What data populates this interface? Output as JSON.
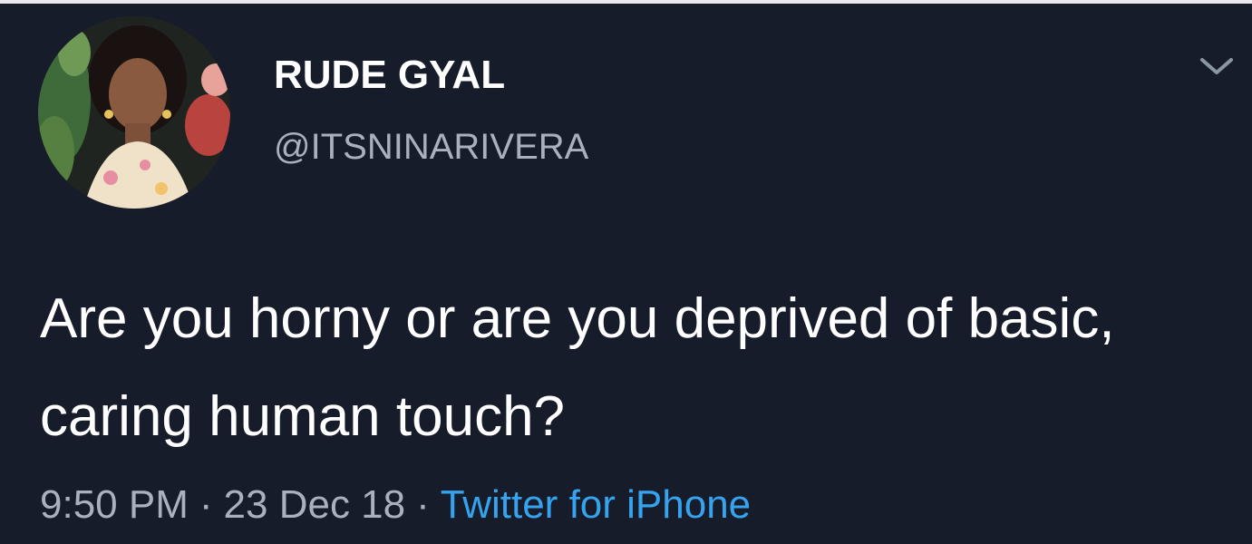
{
  "user": {
    "display_name": "RUDE GYAL",
    "handle": "@ITSNINARIVERA",
    "avatar_icon": "profile-photo"
  },
  "tweet": {
    "text": "Are you horny or are you deprived of basic, caring human touch?"
  },
  "meta": {
    "time": "9:50 PM",
    "date": "23 Dec 18",
    "separator": "·",
    "source": "Twitter for iPhone"
  },
  "menu_icon": "chevron-down-icon",
  "colors": {
    "background": "#161c29",
    "text_primary": "#ffffff",
    "text_secondary": "#a9b1bd",
    "link": "#35a3ee"
  }
}
